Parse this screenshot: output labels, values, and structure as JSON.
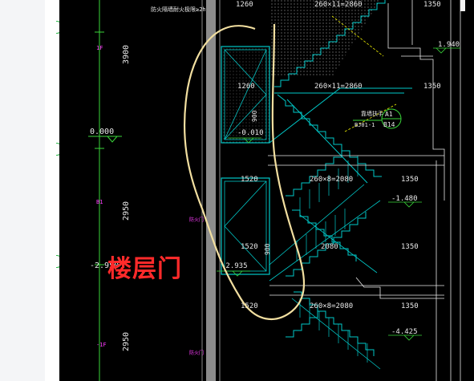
{
  "colors": {
    "canvas_bg": "#000000",
    "annotation": "#ff2a2a",
    "stair_cyan": "#00c8c8",
    "dim_green": "#3ad63a",
    "dim_white": "#e8e8e8",
    "wall_gray": "#8c8c8c",
    "handdrawn": "#f2dfa0",
    "magenta": "#ff3cff",
    "yellow": "#f0f000"
  },
  "annotation": {
    "text": "楼层门"
  },
  "drawing": {
    "top_note": "防火隔墙耐火极限≥2h",
    "dims_left": [
      "3900",
      "2950",
      "2950"
    ],
    "elevations": [
      "0.000",
      "-2.950",
      "-1.480",
      "-4.425",
      "-0.010",
      "-2.935"
    ],
    "dims_top": [
      "1260",
      "260×11=2860",
      "1350"
    ],
    "dims_mid1": [
      "1260",
      "260×11=2860",
      "1350"
    ],
    "dims_mid2": [
      "1520",
      "260×8=2080",
      "1350"
    ],
    "dims_mid3": [
      "1520",
      "2080",
      "1350"
    ],
    "dims_bottom": [
      "1520",
      "260×8=2080",
      "1350"
    ],
    "dim_1940": "1.940",
    "door_heights": [
      "900",
      "900"
    ],
    "tag": {
      "id1": "A1",
      "id2": "B14",
      "note": "靠墙扶手",
      "note2": "BJ01-1"
    },
    "small_labels": [
      "1F",
      "-1F",
      "B1",
      "防火门",
      "防火门"
    ]
  }
}
